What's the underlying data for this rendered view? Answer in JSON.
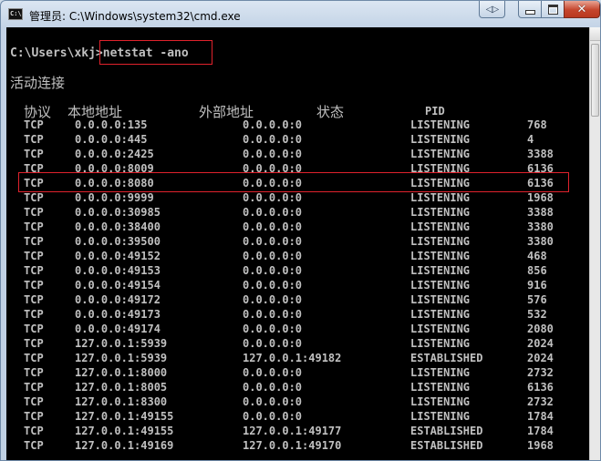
{
  "window": {
    "title": "管理员: C:\\Windows\\system32\\cmd.exe",
    "icon": "cmd-icon",
    "controls": [
      "restore-mini-icon",
      "minimize-icon",
      "maximize-icon",
      "close-icon"
    ]
  },
  "console": {
    "prompt": "C:\\Users\\xkj>",
    "command": "netstat -ano",
    "heading": "活动连接",
    "columns": {
      "proto": "协议",
      "local": "本地地址",
      "foreign": "外部地址",
      "state": "状态",
      "pid": "PID"
    },
    "rows": [
      {
        "proto": "TCP",
        "local": "0.0.0.0:135",
        "foreign": "0.0.0.0:0",
        "state": "LISTENING",
        "pid": "768"
      },
      {
        "proto": "TCP",
        "local": "0.0.0.0:445",
        "foreign": "0.0.0.0:0",
        "state": "LISTENING",
        "pid": "4"
      },
      {
        "proto": "TCP",
        "local": "0.0.0.0:2425",
        "foreign": "0.0.0.0:0",
        "state": "LISTENING",
        "pid": "3388"
      },
      {
        "proto": "TCP",
        "local": "0.0.0.0:8009",
        "foreign": "0.0.0.0:0",
        "state": "LISTENING",
        "pid": "6136"
      },
      {
        "proto": "TCP",
        "local": "0.0.0.0:8080",
        "foreign": "0.0.0.0:0",
        "state": "LISTENING",
        "pid": "6136"
      },
      {
        "proto": "TCP",
        "local": "0.0.0.0:9999",
        "foreign": "0.0.0.0:0",
        "state": "LISTENING",
        "pid": "1968"
      },
      {
        "proto": "TCP",
        "local": "0.0.0.0:30985",
        "foreign": "0.0.0.0:0",
        "state": "LISTENING",
        "pid": "3388"
      },
      {
        "proto": "TCP",
        "local": "0.0.0.0:38400",
        "foreign": "0.0.0.0:0",
        "state": "LISTENING",
        "pid": "3380"
      },
      {
        "proto": "TCP",
        "local": "0.0.0.0:39500",
        "foreign": "0.0.0.0:0",
        "state": "LISTENING",
        "pid": "3380"
      },
      {
        "proto": "TCP",
        "local": "0.0.0.0:49152",
        "foreign": "0.0.0.0:0",
        "state": "LISTENING",
        "pid": "468"
      },
      {
        "proto": "TCP",
        "local": "0.0.0.0:49153",
        "foreign": "0.0.0.0:0",
        "state": "LISTENING",
        "pid": "856"
      },
      {
        "proto": "TCP",
        "local": "0.0.0.0:49154",
        "foreign": "0.0.0.0:0",
        "state": "LISTENING",
        "pid": "916"
      },
      {
        "proto": "TCP",
        "local": "0.0.0.0:49172",
        "foreign": "0.0.0.0:0",
        "state": "LISTENING",
        "pid": "576"
      },
      {
        "proto": "TCP",
        "local": "0.0.0.0:49173",
        "foreign": "0.0.0.0:0",
        "state": "LISTENING",
        "pid": "532"
      },
      {
        "proto": "TCP",
        "local": "0.0.0.0:49174",
        "foreign": "0.0.0.0:0",
        "state": "LISTENING",
        "pid": "2080"
      },
      {
        "proto": "TCP",
        "local": "127.0.0.1:5939",
        "foreign": "0.0.0.0:0",
        "state": "LISTENING",
        "pid": "2024"
      },
      {
        "proto": "TCP",
        "local": "127.0.0.1:5939",
        "foreign": "127.0.0.1:49182",
        "state": "ESTABLISHED",
        "pid": "2024"
      },
      {
        "proto": "TCP",
        "local": "127.0.0.1:8000",
        "foreign": "0.0.0.0:0",
        "state": "LISTENING",
        "pid": "2732"
      },
      {
        "proto": "TCP",
        "local": "127.0.0.1:8005",
        "foreign": "0.0.0.0:0",
        "state": "LISTENING",
        "pid": "6136"
      },
      {
        "proto": "TCP",
        "local": "127.0.0.1:8300",
        "foreign": "0.0.0.0:0",
        "state": "LISTENING",
        "pid": "2732"
      },
      {
        "proto": "TCP",
        "local": "127.0.0.1:49155",
        "foreign": "0.0.0.0:0",
        "state": "LISTENING",
        "pid": "1784"
      },
      {
        "proto": "TCP",
        "local": "127.0.0.1:49155",
        "foreign": "127.0.0.1:49177",
        "state": "ESTABLISHED",
        "pid": "1784"
      },
      {
        "proto": "TCP",
        "local": "127.0.0.1:49169",
        "foreign": "127.0.0.1:49170",
        "state": "ESTABLISHED",
        "pid": "1968"
      }
    ]
  },
  "colors": {
    "console_bg": "#000000",
    "console_text": "#c0c0c0",
    "highlight": "#e0222c"
  }
}
